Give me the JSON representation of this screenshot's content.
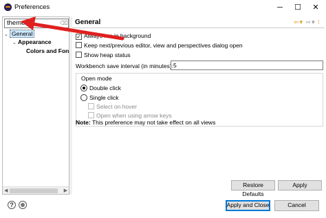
{
  "window": {
    "title": "Preferences",
    "minimize_glyph": "─",
    "maximize_glyph": "☐",
    "close_glyph": "✕"
  },
  "filter": {
    "value": "theme",
    "clear_glyph": "⌫"
  },
  "tree": {
    "items": [
      {
        "label": "General",
        "toggle": "⌄"
      },
      {
        "label": "Appearance",
        "toggle": "⌄"
      },
      {
        "label": "Colors and Fon"
      }
    ]
  },
  "page": {
    "title": "General",
    "nav": {
      "back": "⇦",
      "back_menu": "▾",
      "forward": "⇨",
      "forward_menu": "▾",
      "menu": "⁝"
    },
    "checkboxes": [
      {
        "label": "Always run in background",
        "checked": true,
        "mark": "✓"
      },
      {
        "label": "Keep next/previous editor, view and perspectives dialog open",
        "checked": false,
        "mark": ""
      },
      {
        "label": "Show heap status",
        "checked": false,
        "mark": ""
      }
    ],
    "save_interval_label": "Workbench save interval (in minutes):",
    "save_interval_value": "5",
    "open_mode": {
      "title": "Open mode",
      "double_click": "Double click",
      "single_click": "Single click",
      "select_on_hover": "Select on hover",
      "open_with_arrows": "Open when using arrow keys"
    },
    "note_bold": "Note:",
    "note_text": " This preference may not take effect on all views"
  },
  "buttons": {
    "restore_defaults": "Restore Defaults",
    "apply": "Apply",
    "apply_and_close": "Apply and Close",
    "cancel": "Cancel"
  },
  "footer": {
    "help_glyph": "?"
  },
  "colors": {
    "annotation_arrow": "#e02020",
    "selection": "#cde8ff",
    "focus_border": "#0078d7",
    "nav_arrow": "#d39a1d"
  }
}
